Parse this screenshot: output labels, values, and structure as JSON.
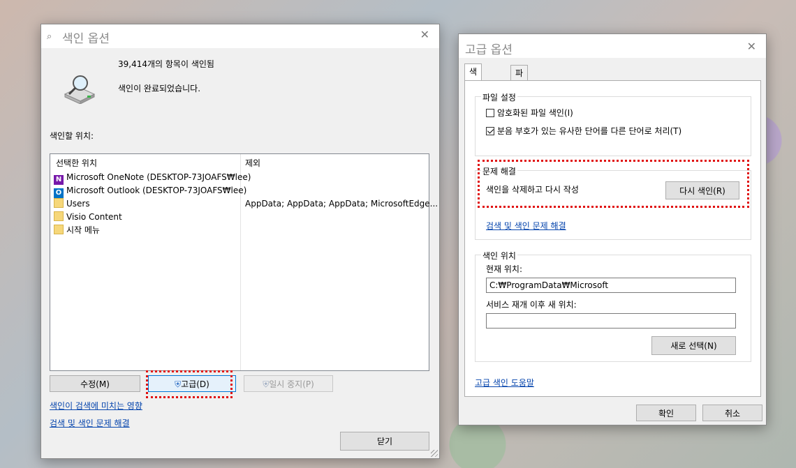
{
  "index_options": {
    "title": "색인 옵션",
    "title_icon": "magnifier-drive-icon",
    "items_indexed": "39,414개의 항목이 색인됨",
    "status": "색인이 완료되었습니다.",
    "index_locations_label": "색인할 위치:",
    "columns": {
      "included": "선택한 위치",
      "excluded": "제외"
    },
    "locations": [
      {
        "icon": "onenote-icon",
        "name": "Microsoft OneNote (DESKTOP-73JOAFS₩lee)",
        "exclude": ""
      },
      {
        "icon": "outlook-icon",
        "name": "Microsoft Outlook (DESKTOP-73JOAFS₩lee)",
        "exclude": ""
      },
      {
        "icon": "folder-icon",
        "name": "Users",
        "exclude": "AppData; AppData; AppData; MicrosoftEdge..."
      },
      {
        "icon": "folder-icon",
        "name": "Visio Content",
        "exclude": ""
      },
      {
        "icon": "folder-icon",
        "name": "시작 메뉴",
        "exclude": ""
      }
    ],
    "buttons": {
      "modify": "수정(M)",
      "advanced": "고급(D)",
      "pause": "일시 중지(P)",
      "close": "닫기"
    },
    "links": {
      "how_affects": "색인이 검색에 미치는 영향",
      "troubleshoot": "검색 및 색인 문제 해결"
    }
  },
  "advanced_options": {
    "title": "고급 옵션",
    "tabs": [
      "색인 설정",
      "파일 형식"
    ],
    "file_settings": {
      "label": "파일 설정",
      "encrypt": {
        "label": "암호화된 파일 색인(I)",
        "checked": false
      },
      "diacritics": {
        "label": "분음 부호가 있는 유사한 단어를 다른 단어로 처리(T)",
        "checked": true
      }
    },
    "troubleshooting": {
      "label": "문제 해결",
      "rebuild_text": "색인을 삭제하고 다시 작성",
      "rebuild_button": "다시 색인(R)",
      "link": "검색 및 색인 문제 해결"
    },
    "index_location": {
      "label": "색인 위치",
      "current_label": "현재 위치:",
      "current_value": "C:₩ProgramData₩Microsoft",
      "new_label": "서비스 재개 이후 새 위치:",
      "new_value": "",
      "select_button": "새로 선택(N)"
    },
    "help_link": "고급 색인 도움말",
    "ok": "확인",
    "cancel": "취소"
  },
  "colors": {
    "highlight": "#e01010",
    "link": "#0645ad"
  }
}
